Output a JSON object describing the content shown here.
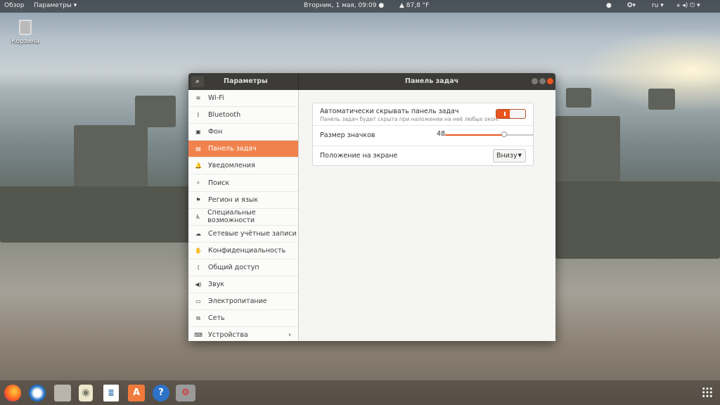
{
  "topbar": {
    "activities": "Обзор",
    "app_menu": "Параметры ▾",
    "clock": "Вторник, 1 мая, 09:09 ●",
    "weather": "▲ 87,8 °F",
    "lang": "ru ▾"
  },
  "desktop": {
    "trash_label": "Корзина"
  },
  "window": {
    "sidebar_title": "Параметры",
    "title": "Панель задач"
  },
  "sidebar": {
    "items": [
      {
        "label": "Wi-Fi",
        "icon": "wifi-icon",
        "glyph": "≋"
      },
      {
        "label": "Bluetooth",
        "icon": "bluetooth-icon",
        "glyph": "ᛒ"
      },
      {
        "label": "Фон",
        "icon": "background-icon",
        "glyph": "▣"
      },
      {
        "label": "Панель задач",
        "icon": "dock-icon",
        "glyph": "▤",
        "selected": true
      },
      {
        "label": "Уведомления",
        "icon": "bell-icon",
        "glyph": "🔔"
      },
      {
        "label": "Поиск",
        "icon": "search-icon",
        "glyph": "⌕"
      },
      {
        "label": "Регион и язык",
        "icon": "flag-icon",
        "glyph": "⚑"
      },
      {
        "label": "Специальные возможности",
        "icon": "accessibility-icon",
        "glyph": "♿"
      },
      {
        "label": "Сетевые учётные записи",
        "icon": "online-accounts-icon",
        "glyph": "☁"
      },
      {
        "label": "Конфиденциальность",
        "icon": "privacy-icon",
        "glyph": "✋"
      },
      {
        "label": "Общий доступ",
        "icon": "share-icon",
        "glyph": "⟨"
      },
      {
        "label": "Звук",
        "icon": "sound-icon",
        "glyph": "◀)"
      },
      {
        "label": "Электропитание",
        "icon": "power-icon",
        "glyph": "▭"
      },
      {
        "label": "Сеть",
        "icon": "network-icon",
        "glyph": "⧉"
      },
      {
        "label": "Устройства",
        "icon": "devices-icon",
        "glyph": "⌨",
        "chevron": "›"
      }
    ]
  },
  "settings": {
    "autohide_label": "Автоматически скрывать панель задач",
    "autohide_desc": "Панель задач будет скрыта при наложении на неё любых окон.",
    "autohide_on": true,
    "icon_size_label": "Размер значков",
    "icon_size_value": "48",
    "icon_size_fraction": 0.67,
    "position_label": "Положение на экране",
    "position_value": "Внизу",
    "accent": "#e95420"
  }
}
